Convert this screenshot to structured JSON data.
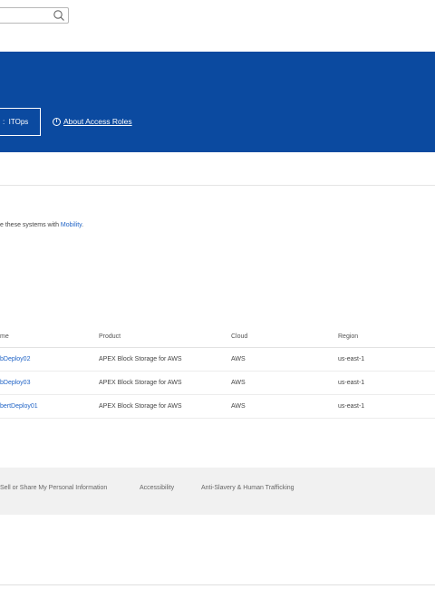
{
  "search": {
    "value": ""
  },
  "banner": {
    "role_label": "ITOps",
    "about_link": "About Access Roles"
  },
  "intro": {
    "text_prefix": "e these systems with ",
    "link": "Mobility",
    "text_suffix": "."
  },
  "table": {
    "columns": [
      "me",
      "Product",
      "Cloud",
      "Region"
    ],
    "rows": [
      {
        "name": "bDeploy02",
        "product": "APEX Block Storage for AWS",
        "cloud": "AWS",
        "region": "us-east-1"
      },
      {
        "name": "bDeploy03",
        "product": "APEX Block Storage for AWS",
        "cloud": "AWS",
        "region": "us-east-1"
      },
      {
        "name": "bertDeploy01",
        "product": "APEX Block Storage for AWS",
        "cloud": "AWS",
        "region": "us-east-1"
      }
    ]
  },
  "footer": {
    "links": [
      "Sell or Share My Personal Information",
      "Accessibility",
      "Anti-Slavery & Human Trafficking"
    ]
  },
  "colors": {
    "banner": "#0b4aa0",
    "link": "#1f63c6",
    "footer_bg": "#f1f1f1"
  },
  "icons": {
    "search": "search-icon",
    "info": "info-icon"
  }
}
